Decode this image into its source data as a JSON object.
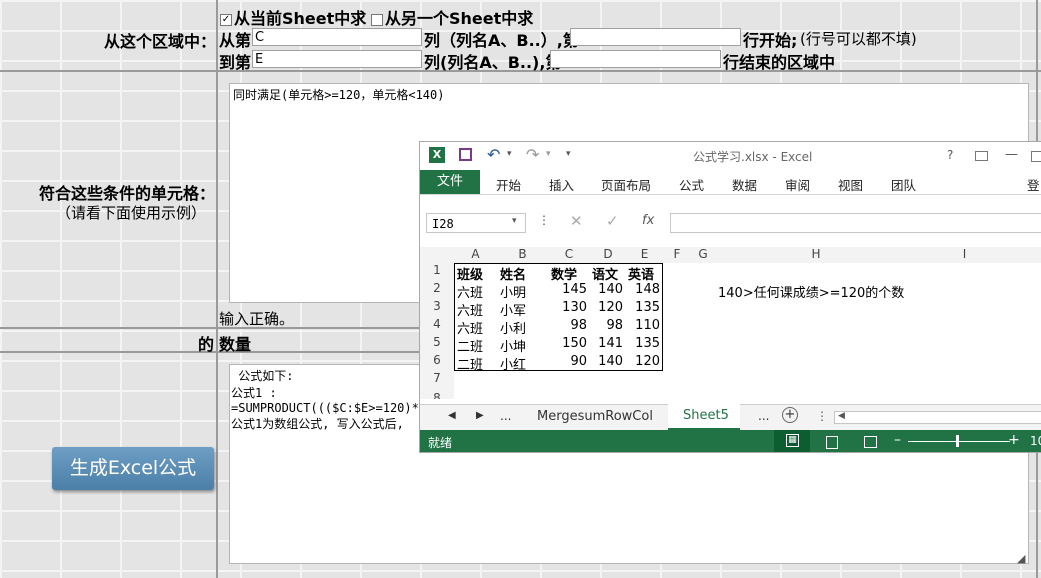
{
  "form": {
    "row1": {
      "label": "从这个区域中：",
      "opt_current": "从当前Sheet中求",
      "opt_other": "从另一个Sheet中求",
      "from_col_label": "从第",
      "from_col_value": "C",
      "col_hint": "列（列名A、B..）,第",
      "row_start_label": "行开始;",
      "row_start_hint": "(行号可以都不填)",
      "to_col_label": "到第",
      "to_col_value": "E",
      "col_hint2": "列(列名A、B..),第",
      "row_end_label": "行结束的区域中"
    },
    "row2": {
      "label": "符合这些条件的单元格：",
      "sublabel": "（请看下面使用示例）",
      "condition_text": "同时满足(单元格>=120，单元格<140)",
      "footer_text": "输入正确。"
    },
    "row3": {
      "label": "的",
      "value": "数量"
    },
    "row4": {
      "formula_text": " 公式如下:\n公式1 :\n=SUMPRODUCT((($C:$E>=120)*($C\n公式1为数组公式, 写入公式后,",
      "button_label": "生成Excel公式"
    }
  },
  "excel": {
    "title": "公式学习.xlsx - Excel",
    "help": "?",
    "ribbon_tabs": [
      "文件",
      "开始",
      "插入",
      "页面布局",
      "公式",
      "数据",
      "审阅",
      "视图",
      "团队"
    ],
    "login": "登",
    "name_box": "I28",
    "fx": "fx",
    "col_headers": [
      "A",
      "B",
      "C",
      "D",
      "E",
      "F",
      "G",
      "H",
      "I"
    ],
    "row_headers": [
      "1",
      "2",
      "3",
      "4",
      "5",
      "6",
      "7",
      "8"
    ],
    "table_header": [
      "班级",
      "姓名",
      "数学",
      "语文",
      "英语"
    ],
    "rows": [
      [
        "六班",
        "小明",
        "145",
        "140",
        "148"
      ],
      [
        "六班",
        "小军",
        "130",
        "120",
        "135"
      ],
      [
        "六班",
        "小利",
        "98",
        "98",
        "110"
      ],
      [
        "二班",
        "小坤",
        "150",
        "141",
        "135"
      ],
      [
        "二班",
        "小红",
        "90",
        "140",
        "120"
      ]
    ],
    "h2": "140>任何课成绩>=120的个数",
    "sheet_tabs": [
      "MergesumRowCol",
      "Sheet5"
    ],
    "active_sheet": "Sheet5",
    "ellipsis": "...",
    "status_left": "就绪",
    "zoom_fragment": "10",
    "accent": "#217346"
  }
}
